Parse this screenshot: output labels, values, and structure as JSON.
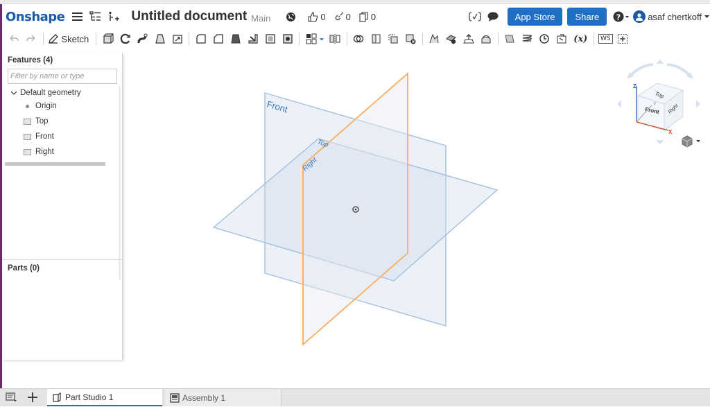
{
  "header": {
    "logo": "Onshape",
    "document_title": "Untitled document",
    "branch": "Main",
    "likes": "0",
    "links": "0",
    "copies": "0",
    "app_store_label": "App Store",
    "share_label": "Share",
    "user_name": "asaf chertkoff"
  },
  "toolbar": {
    "sketch_label": "Sketch",
    "workspace_units": "WS",
    "variable_label": "(x)"
  },
  "features": {
    "title": "Features (4)",
    "filter_placeholder": "Filter by name or type",
    "group_label": "Default geometry",
    "items": [
      {
        "label": "Origin",
        "icon": "origin-icon"
      },
      {
        "label": "Top",
        "icon": "plane-icon"
      },
      {
        "label": "Front",
        "icon": "plane-icon"
      },
      {
        "label": "Right",
        "icon": "plane-icon"
      }
    ]
  },
  "parts": {
    "title": "Parts (0)"
  },
  "viewport": {
    "front_plane_label": "Front",
    "top_plane_label": "Top",
    "right_plane_label": "Right"
  },
  "viewcube": {
    "z_label": "Z",
    "x_label": "X",
    "y_label": "Y",
    "top_face": "Top",
    "front_face": "Front",
    "right_face": "Right"
  },
  "tabs": [
    {
      "label": "Part Studio 1",
      "active": true
    },
    {
      "label": "Assembly 1",
      "active": false
    }
  ],
  "colors": {
    "brand": "#1b5bab",
    "button": "#1f6fc5",
    "plane_blue": "#8fb1d6",
    "plane_selected": "#f6b46b"
  }
}
